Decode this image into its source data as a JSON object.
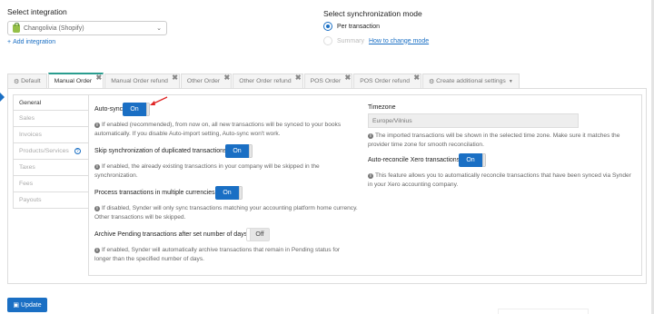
{
  "integration": {
    "title": "Select integration",
    "selected": "Changolivia (Shopify)",
    "add_link": "Add integration"
  },
  "sync_mode": {
    "title": "Select synchronization mode",
    "options": [
      {
        "label": "Per transaction",
        "selected": true
      },
      {
        "label": "Summary",
        "selected": false,
        "link": "How to change mode"
      }
    ]
  },
  "tabs": [
    {
      "label": "Default",
      "icon": "gear-icon",
      "active": false,
      "closable": false
    },
    {
      "label": "Manual Order",
      "active": true,
      "closable": true
    },
    {
      "label": "Manual Order refund",
      "active": false,
      "closable": true
    },
    {
      "label": "Other Order",
      "active": false,
      "closable": true
    },
    {
      "label": "Other Order refund",
      "active": false,
      "closable": true
    },
    {
      "label": "POS Order",
      "active": false,
      "closable": true
    },
    {
      "label": "POS Order refund",
      "active": false,
      "closable": true
    },
    {
      "label": "Create additional settings",
      "icon": "gear-icon",
      "active": false,
      "closable": false
    }
  ],
  "sidebar": {
    "items": [
      {
        "label": "General",
        "active": true
      },
      {
        "label": "Sales",
        "active": false
      },
      {
        "label": "Invoices",
        "active": false
      },
      {
        "label": "Products/Services",
        "active": false,
        "help": "?"
      },
      {
        "label": "Taxes",
        "active": false
      },
      {
        "label": "Fees",
        "active": false
      },
      {
        "label": "Payouts",
        "active": false
      }
    ]
  },
  "settings": {
    "auto_sync": {
      "label": "Auto-sync",
      "state": "On",
      "help": "If enabled (recommended), from now on, all new transactions will be synced to your books automatically. If you disable Auto-import setting, Auto-sync won't work."
    },
    "skip_duplicates": {
      "label": "Skip synchronization of duplicated transactions",
      "state": "On",
      "help": "If enabled, the already existing transactions in your company will be skipped in the synchronization."
    },
    "multi_currency": {
      "label": "Process transactions in multiple currencies.",
      "state": "On",
      "help": "If disabled, Synder will only sync transactions matching your accounting platform home currency. Other transactions will be skipped."
    },
    "archive_pending": {
      "label": "Archive Pending transactions after set number of days",
      "state": "Off",
      "help": "If enabled, Synder will automatically archive transactions that remain in Pending status for longer than the specified number of days."
    },
    "timezone": {
      "label": "Timezone",
      "value": "Europe/Vilnius",
      "help": "The imported transactions will be shown in the selected time zone. Make sure it matches the provider time zone for smooth reconcilation."
    },
    "auto_reconcile": {
      "label": "Auto-reconcile Xero transactions",
      "state": "On",
      "help": "This feature allows you to automatically reconcile transactions that have been synced via Synder in your Xero accounting company."
    }
  },
  "footer": {
    "update_label": "Update"
  },
  "colors": {
    "primary": "#1a6fc4",
    "active_tab_border": "#2a9d8f",
    "annotation_arrow": "#e02424"
  }
}
